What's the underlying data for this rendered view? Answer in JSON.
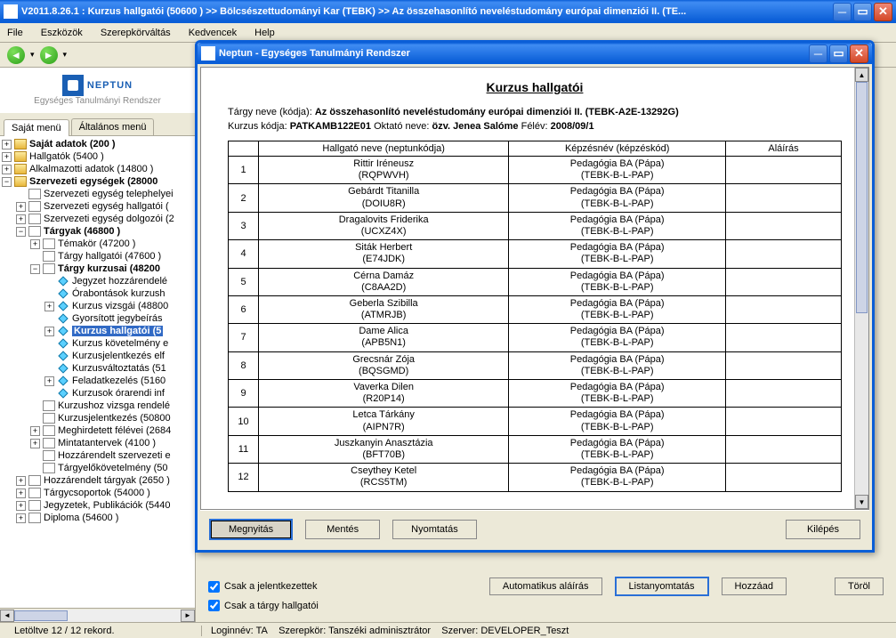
{
  "main_window": {
    "title": "V2011.8.26.1 : Kurzus hallgatói (50600  )  >> Bölcsészettudományi Kar (TEBK)  >> Az összehasonlító neveléstudomány európai dimenziói II. (TE..."
  },
  "menu": {
    "file": "File",
    "eszkozok": "Eszközök",
    "szerepkorvaltas": "Szerepkörváltás",
    "kedvencek": "Kedvencek",
    "help": "Help"
  },
  "logo": {
    "brand": "NEPTUN",
    "sub": "Egységes Tanulmányi Rendszer"
  },
  "tabs": {
    "sajat": "Saját menü",
    "altalanos": "Általános menü"
  },
  "tree": {
    "sajat_adatok": "Saját adatok (200  )",
    "hallgatok": "Hallgatók (5400  )",
    "alkalmazotti": "Alkalmazotti adatok (14800  )",
    "szervezeti": "Szervezeti egységek (28000",
    "sz_telephelyei": "Szervezeti egység telephelyei",
    "sz_hallgatoi": "Szervezeti egység hallgatói (",
    "sz_dolgozoi": "Szervezeti egység dolgozói (2",
    "targyak": "Tárgyak (46800  )",
    "temakor": "Témakör (47200  )",
    "targy_hallgatoi": "Tárgy hallgatói (47600  )",
    "targy_kurzusai": "Tárgy kurzusai (48200",
    "jegyzet_hozz": "Jegyzet hozzárendelé",
    "orabontasok": "Órabontások kurzush",
    "kurzus_vizsgai": "Kurzus vizsgái (48800",
    "gyorsitott": "Gyorsított jegybeírás",
    "kurzus_hallgatoi": "Kurzus hallgatói (5",
    "kurzus_kovetelmeny": "Kurzus követelmény e",
    "kurzusjelentkezes_e": "Kurzusjelentkezés elf",
    "kurzusvaltoztatas": "Kurzusváltoztatás (51",
    "feladatkezeles": "Feladatkezelés (5160",
    "kurzusok_orarendi": "Kurzusok órarendi inf",
    "kurzushoz_vizsga": "Kurzushoz vizsga rendelé",
    "kurzusjelentkezes": "Kurzusjelentkezés (50800",
    "meghirdetett": "Meghirdetett félévei (2684",
    "mintatantervek": "Mintatantervek (4100  )",
    "hozzarendelt": "Hozzárendelt szervezeti e",
    "targyelokovetelmeny": "Tárgyelőkövetelmény (50",
    "hozz_targyak": "Hozzárendelt tárgyak (2650  )",
    "targycsoportok": "Tárgycsoportok (54000  )",
    "jegyzetek": "Jegyzetek, Publikációk (5440",
    "diploma": "Diploma (54600  )"
  },
  "lower": {
    "csak_jelentkezettek": "Csak a jelentkezettek",
    "csak_targy_hallgatoi": "Csak a tárgy hallgatói",
    "auto_alairas": "Automatikus aláírás",
    "listanyomtatas": "Listanyomtatás",
    "hozzaad": "Hozzáad",
    "torol": "Töröl"
  },
  "dialog": {
    "title": "Neptun - Egységes Tanulmányi Rendszer",
    "buttons": {
      "megnyitas": "Megnyitás",
      "mentes": "Mentés",
      "nyomtatas": "Nyomtatás",
      "kilepes": "Kilépés"
    }
  },
  "report": {
    "title": "Kurzus hallgatói",
    "meta1_label": "Tárgy neve (kódja):",
    "meta1_value": "Az összehasonlító neveléstudomány európai dimenziói II. (TEBK-A2E-13292G)",
    "meta2_kurzus_l": "Kurzus kódja:",
    "meta2_kurzus_v": "PATKAMB122E01",
    "meta2_oktato_l": "Oktató neve:",
    "meta2_oktato_v": "özv. Jenea Salóme",
    "meta2_felev_l": "Félév:",
    "meta2_felev_v": "2008/09/1",
    "headers": {
      "num": "",
      "hallgato": "Hallgató neve (neptunkódja)",
      "kepzes": "Képzésnév (képzéskód)",
      "alairas": "Aláírás"
    },
    "rows": [
      {
        "n": "1",
        "name": "Rittir Iréneusz",
        "code": "(RQPWVH)",
        "kep": "Pedagógia BA (Pápa)",
        "kcode": "(TEBK-B-L-PAP)"
      },
      {
        "n": "2",
        "name": "Gebárdt Titanilla",
        "code": "(DOIU8R)",
        "kep": "Pedagógia BA (Pápa)",
        "kcode": "(TEBK-B-L-PAP)"
      },
      {
        "n": "3",
        "name": "Dragalovits Friderika",
        "code": "(UCXZ4X)",
        "kep": "Pedagógia BA (Pápa)",
        "kcode": "(TEBK-B-L-PAP)"
      },
      {
        "n": "4",
        "name": "Siták Herbert",
        "code": "(E74JDK)",
        "kep": "Pedagógia BA (Pápa)",
        "kcode": "(TEBK-B-L-PAP)"
      },
      {
        "n": "5",
        "name": "Cérna Damáz",
        "code": "(C8AA2D)",
        "kep": "Pedagógia BA (Pápa)",
        "kcode": "(TEBK-B-L-PAP)"
      },
      {
        "n": "6",
        "name": "Geberla Szibilla",
        "code": "(ATMRJB)",
        "kep": "Pedagógia BA (Pápa)",
        "kcode": "(TEBK-B-L-PAP)"
      },
      {
        "n": "7",
        "name": "Dame Alica",
        "code": "(APB5N1)",
        "kep": "Pedagógia BA (Pápa)",
        "kcode": "(TEBK-B-L-PAP)"
      },
      {
        "n": "8",
        "name": "Grecsnár Zója",
        "code": "(BQSGMD)",
        "kep": "Pedagógia BA (Pápa)",
        "kcode": "(TEBK-B-L-PAP)"
      },
      {
        "n": "9",
        "name": "Vaverka Dilen",
        "code": "(R20P14)",
        "kep": "Pedagógia BA (Pápa)",
        "kcode": "(TEBK-B-L-PAP)"
      },
      {
        "n": "10",
        "name": "Letca Tárkány",
        "code": "(AIPN7R)",
        "kep": "Pedagógia BA (Pápa)",
        "kcode": "(TEBK-B-L-PAP)"
      },
      {
        "n": "11",
        "name": "Juszkanyin Anasztázia",
        "code": "(BFT70B)",
        "kep": "Pedagógia BA (Pápa)",
        "kcode": "(TEBK-B-L-PAP)"
      },
      {
        "n": "12",
        "name": "Cseythey Ketel",
        "code": "(RCS5TM)",
        "kep": "Pedagógia BA (Pápa)",
        "kcode": "(TEBK-B-L-PAP)"
      }
    ]
  },
  "status": {
    "records": "Letöltve 12 / 12 rekord.",
    "login_l": "Loginnév:",
    "login_v": "TA",
    "role_l": "Szerepkör:",
    "role_v": "Tanszéki adminisztrátor",
    "server_l": "Szerver:",
    "server_v": "DEVELOPER_Teszt"
  }
}
